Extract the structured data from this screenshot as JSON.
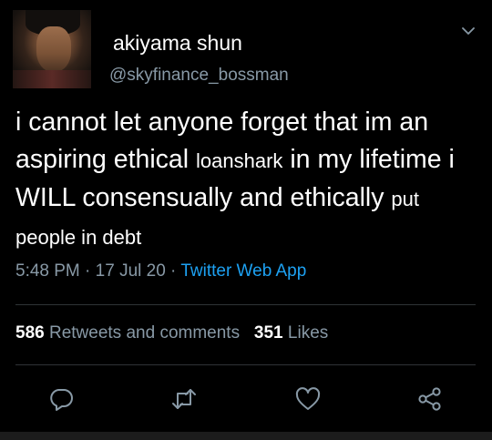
{
  "user": {
    "display_name": "akiyama shun",
    "handle": "@skyfinance_bossman"
  },
  "tweet": {
    "text_segments": [
      "i cannot let anyone forget that im an aspiring ethical ",
      "loanshark",
      " in my lifetime i WILL consensually and ethically ",
      "put people in debt"
    ],
    "time": "5:48 PM",
    "separator": " · ",
    "date": "17 Jul 20",
    "source": "Twitter Web App"
  },
  "stats": {
    "retweets_count": "586",
    "retweets_label": "Retweets and comments",
    "likes_count": "351",
    "likes_label": "Likes"
  },
  "icons": {
    "menu": "chevron-down-icon",
    "reply": "reply-icon",
    "retweet": "retweet-icon",
    "like": "heart-icon",
    "share": "share-icon"
  },
  "colors": {
    "background": "#000000",
    "text": "#ffffff",
    "secondary": "#8899a6",
    "link": "#1da1f2",
    "divider": "#2f3336"
  }
}
